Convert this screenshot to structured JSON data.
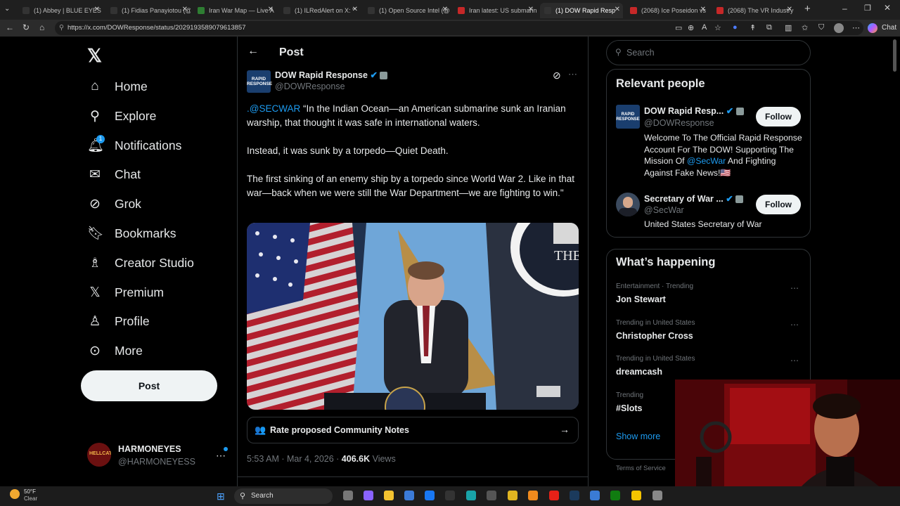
{
  "browser": {
    "tabs": [
      {
        "label": "(1) Abbey | BLUE EYES c",
        "color": "#333"
      },
      {
        "label": "(1) Fidias Panayiotou (@",
        "color": "#333"
      },
      {
        "label": "Iran War Map — Live A",
        "color": "#2e7d32"
      },
      {
        "label": "(1) ILRedAlert on X: \"",
        "color": "#333"
      },
      {
        "label": "(1) Open Source Intel (@",
        "color": "#333"
      },
      {
        "label": "Iran latest: US submarin",
        "color": "#c62828"
      },
      {
        "label": "(1) DOW Rapid Resp",
        "color": "#333"
      },
      {
        "label": "(2068) Ice Poseidon vs",
        "color": "#c62828"
      },
      {
        "label": "(2068) The VR Industry",
        "color": "#c62828"
      }
    ],
    "url": "https://x.com/DOWResponse/status/2029193589079613857",
    "copilot_label": "Chat"
  },
  "nav": {
    "items": [
      {
        "label": "Home",
        "icon": "home-icon"
      },
      {
        "label": "Explore",
        "icon": "search-icon"
      },
      {
        "label": "Notifications",
        "icon": "bell-icon"
      },
      {
        "label": "Chat",
        "icon": "mail-icon"
      },
      {
        "label": "Grok",
        "icon": "grok-icon"
      },
      {
        "label": "Bookmarks",
        "icon": "bookmark-icon"
      },
      {
        "label": "Creator Studio",
        "icon": "creator-icon"
      },
      {
        "label": "Premium",
        "icon": "x-logo-icon"
      },
      {
        "label": "Profile",
        "icon": "person-icon"
      },
      {
        "label": "More",
        "icon": "more-icon"
      }
    ],
    "notification_badge": "1",
    "post_button": "Post",
    "account": {
      "name": "HARMONEYES",
      "handle": "@HARMONEYESS"
    }
  },
  "post": {
    "header_title": "Post",
    "author_name": "DOW Rapid Response",
    "author_handle": "@DOWResponse",
    "avatar_text": "RAPID RESPONSE",
    "mention": ".@SECWAR",
    "para1": " “In the Indian Ocean—an American submarine sunk an Iranian warship, that thought it was safe in international waters.",
    "para2": "Instead, it was sunk by a torpedo—Quiet Death.",
    "para3": "The first sinking of an enemy ship by a torpedo since World War 2. Like in that war—back when we were still the War Department—we are fighting to win.\"",
    "community_notes": "Rate proposed Community Notes",
    "time": "5:53 AM · Mar 4, 2026 · ",
    "views_count": "406.6K",
    "views_label": " Views",
    "seal_text": "THE"
  },
  "sidebar": {
    "search_placeholder": "Search",
    "relevant_title": "Relevant people",
    "people": [
      {
        "name": "DOW Rapid Resp...",
        "handle": "@DOWResponse",
        "follow": "Follow",
        "bio_pre": "Welcome To The Official Rapid Response Account For The DOW! Supporting The Mission Of ",
        "bio_link": "@SecWar",
        "bio_post": " And Fighting Against Fake News!🇺🇸"
      },
      {
        "name": "Secretary of War ...",
        "handle": "@SecWar",
        "follow": "Follow",
        "bio_pre": "United States Secretary of War",
        "bio_link": "",
        "bio_post": ""
      }
    ],
    "happening_title": "What’s happening",
    "trends": [
      {
        "meta": "Entertainment · Trending",
        "name": "Jon Stewart"
      },
      {
        "meta": "Trending in United States",
        "name": "Christopher Cross"
      },
      {
        "meta": "Trending in United States",
        "name": "dreamcash"
      },
      {
        "meta": "Trending",
        "name": "#Slots"
      }
    ],
    "show_more": "Show more",
    "footer": "Terms of Service"
  },
  "taskbar": {
    "weather_temp": "50°F",
    "weather_desc": "Clear",
    "search": "Search"
  }
}
